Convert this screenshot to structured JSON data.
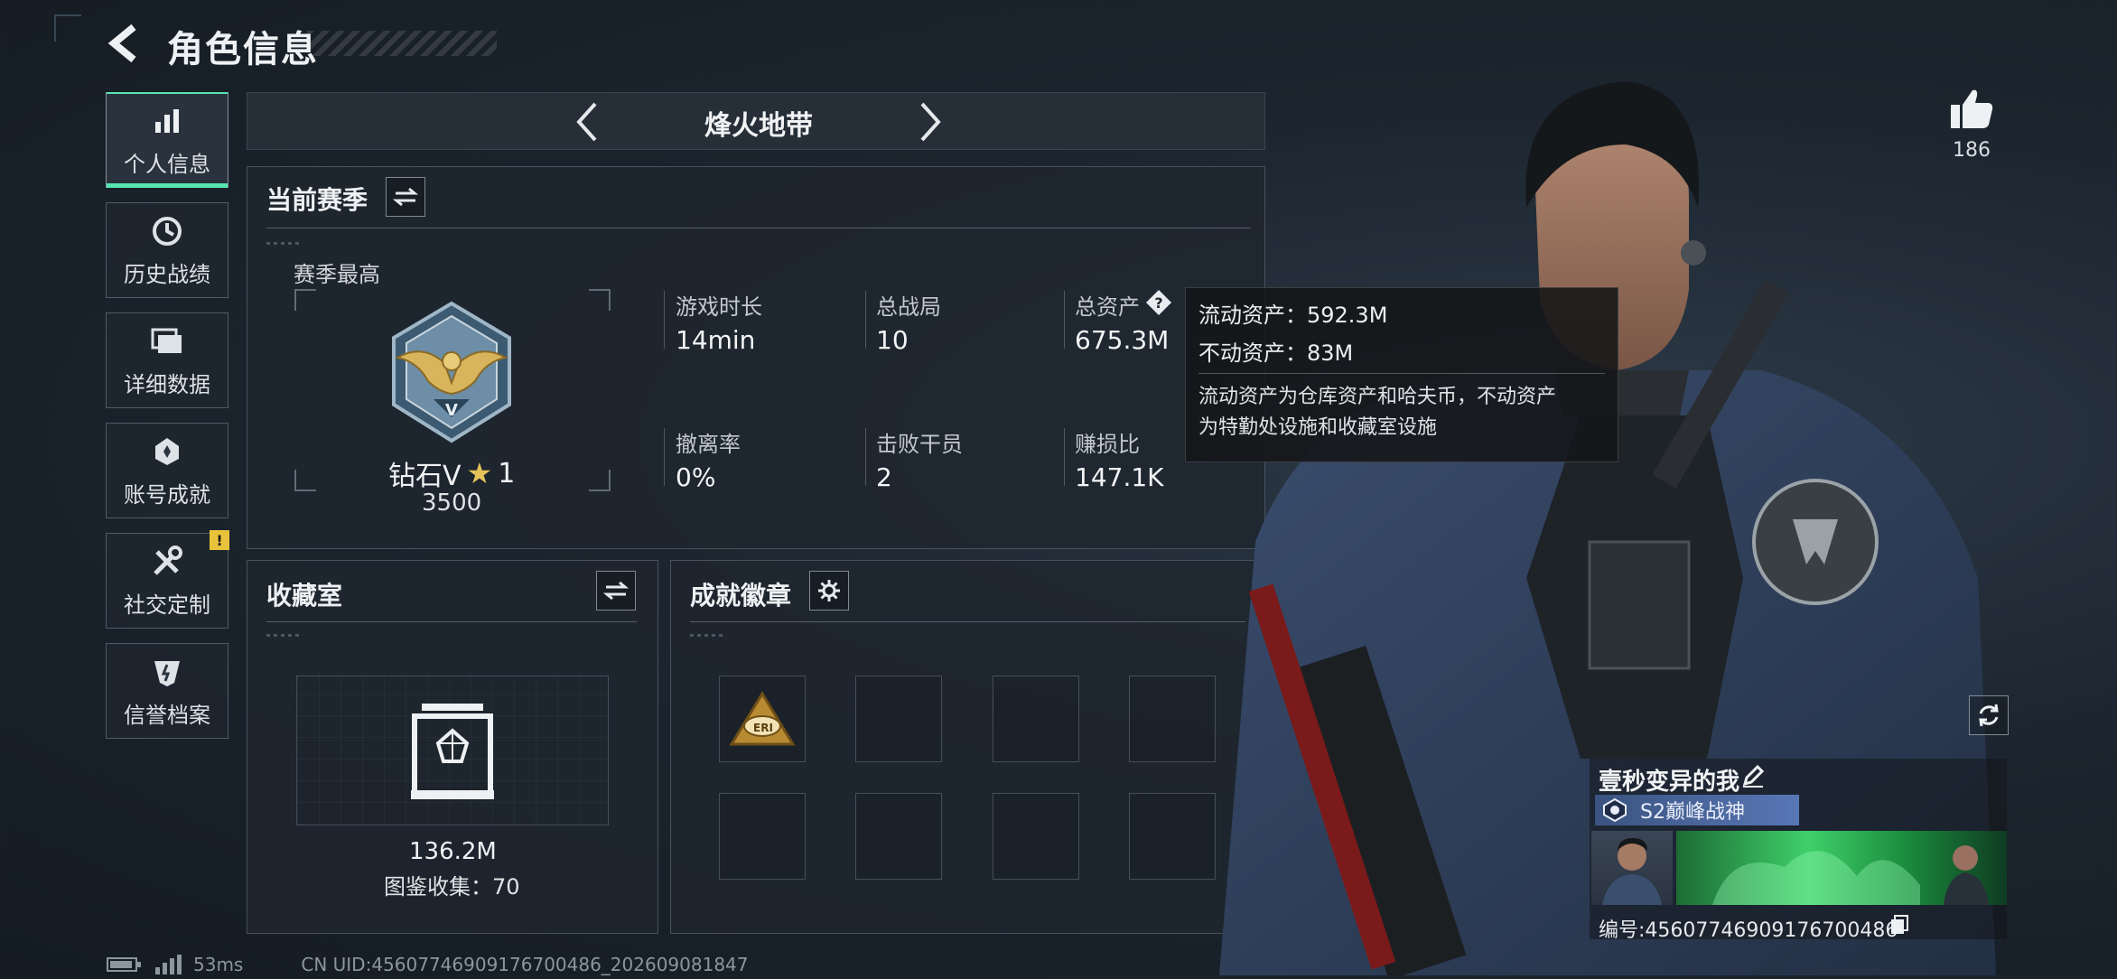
{
  "header": {
    "title": "角色信息"
  },
  "nav": [
    {
      "label": "个人信息",
      "icon": "bar-chart-icon",
      "active": true
    },
    {
      "label": "历史战绩",
      "icon": "clock-history-icon",
      "active": false
    },
    {
      "label": "详细数据",
      "icon": "folders-icon",
      "active": false
    },
    {
      "label": "账号成就",
      "icon": "achievement-medal-icon",
      "active": false
    },
    {
      "label": "社交定制",
      "icon": "tools-icon",
      "active": false,
      "alert": "!"
    },
    {
      "label": "信誉档案",
      "icon": "credit-shield-icon",
      "active": false
    }
  ],
  "mode": {
    "title": "烽火地带"
  },
  "season": {
    "title": "当前赛季",
    "highest_label": "赛季最高",
    "rank_name": "钻石V",
    "rank_stars": "1",
    "rank_points": "3500",
    "stats": [
      {
        "label": "游戏时长",
        "value": "14min"
      },
      {
        "label": "总战局",
        "value": "10"
      },
      {
        "label": "总资产",
        "value": "675.3M"
      },
      {
        "label": "撤离率",
        "value": "0%"
      },
      {
        "label": "击败干员",
        "value": "2"
      },
      {
        "label": "赚损比",
        "value": "147.1K"
      }
    ]
  },
  "tooltip": {
    "liquid": "流动资产：592.3M",
    "fixed": "不动资产：83M",
    "desc_line1": "流动资产为仓库资产和哈夫币，不动资产",
    "desc_line2": "为特勤处设施和收藏室设施"
  },
  "collection": {
    "title": "收藏室",
    "value": "136.2M",
    "catalog": "图鉴收集：70"
  },
  "badges": {
    "title": "成就徽章",
    "first_badge_text": "ERI"
  },
  "character": {
    "likes": "186",
    "player_name": "壹秒变异的我",
    "player_title": "S2巅峰战神",
    "player_id": "编号:4560774690917670​0486"
  },
  "status": {
    "latency": "53ms",
    "uid": "CN UID:45607746909176700486_202609081847"
  },
  "colors": {
    "accent": "#55e6b0",
    "alert": "#e8c23a",
    "title_plate": "#4a66a0"
  }
}
